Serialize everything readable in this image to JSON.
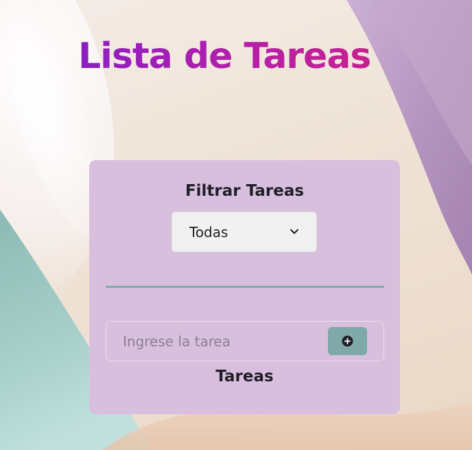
{
  "header": {
    "title": "Lista de Tareas"
  },
  "filter": {
    "label": "Filtrar Tareas",
    "selected": "Todas",
    "icon": "chevron-down-icon"
  },
  "task_input": {
    "placeholder": "Ingrese la tarea",
    "value": "",
    "add_icon": "plus-circle-icon"
  },
  "tasks": {
    "heading": "Tareas",
    "items": []
  },
  "colors": {
    "title_gradient_start": "#8b1fc2",
    "title_gradient_end": "#c6208f",
    "card_background": "#d9bfde",
    "accent_teal": "#7fa9a8",
    "text_dark": "#1f1f2a"
  }
}
